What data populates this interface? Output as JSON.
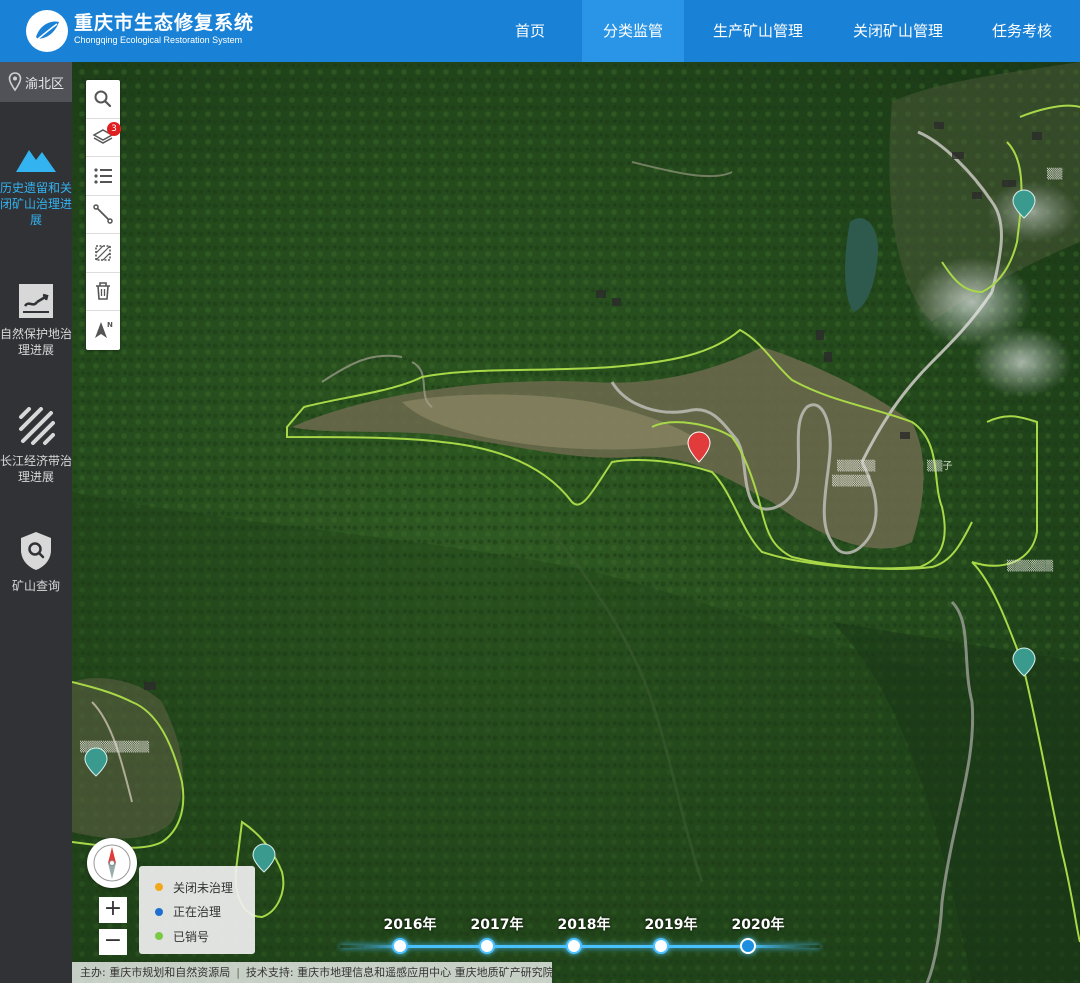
{
  "header": {
    "title": "重庆市生态修复系统",
    "subtitle": "Chongqing Ecological Restoration System",
    "nav": [
      {
        "label": "首页",
        "active": false
      },
      {
        "label": "分类监管",
        "active": true
      },
      {
        "label": "生产矿山管理",
        "active": false
      },
      {
        "label": "关闭矿山管理",
        "active": false
      },
      {
        "label": "任务考核",
        "active": false
      }
    ]
  },
  "sidebar": {
    "region": "渝北区",
    "items": [
      {
        "label": "历史遗留和关闭矿山治理进展",
        "icon": "mountain-icon",
        "active": true
      },
      {
        "label": "自然保护地治理进展",
        "icon": "nature-reserve-icon",
        "active": false
      },
      {
        "label": "长江经济带治理进展",
        "icon": "river-belt-icon",
        "active": false
      },
      {
        "label": "矿山查询",
        "icon": "shield-search-icon",
        "active": false
      }
    ]
  },
  "toolbar": {
    "tools": [
      "search-icon",
      "layers-icon",
      "list-icon",
      "measure-line-icon",
      "measure-area-icon",
      "trash-icon",
      "north-arrow-icon"
    ],
    "layers_badge": "3"
  },
  "zoom": {
    "plus": "+",
    "minus": "−"
  },
  "legend": {
    "items": [
      {
        "label": "关闭未治理",
        "color": "#f2a81d"
      },
      {
        "label": "正在治理",
        "color": "#1f6fd0"
      },
      {
        "label": "已销号",
        "color": "#7ac943"
      }
    ]
  },
  "timeline": {
    "years": [
      "2016年",
      "2017年",
      "2018年",
      "2019年",
      "2020年"
    ],
    "active_index": 4
  },
  "footer": {
    "host": "主办: 重庆市规划和自然资源局",
    "support": "技术支持: 重庆市地理信息和遥感应用中心 重庆地质矿产研究院"
  },
  "colors": {
    "header_bg": "#1a82d6",
    "nav_active_bg": "#2a95e6",
    "sidebar_bg": "#303236",
    "sidebar_active": "#33b3f0",
    "boundary_line": "#a8d848",
    "marker_red": "#e23b3b",
    "marker_teal": "#3a9a8e"
  }
}
